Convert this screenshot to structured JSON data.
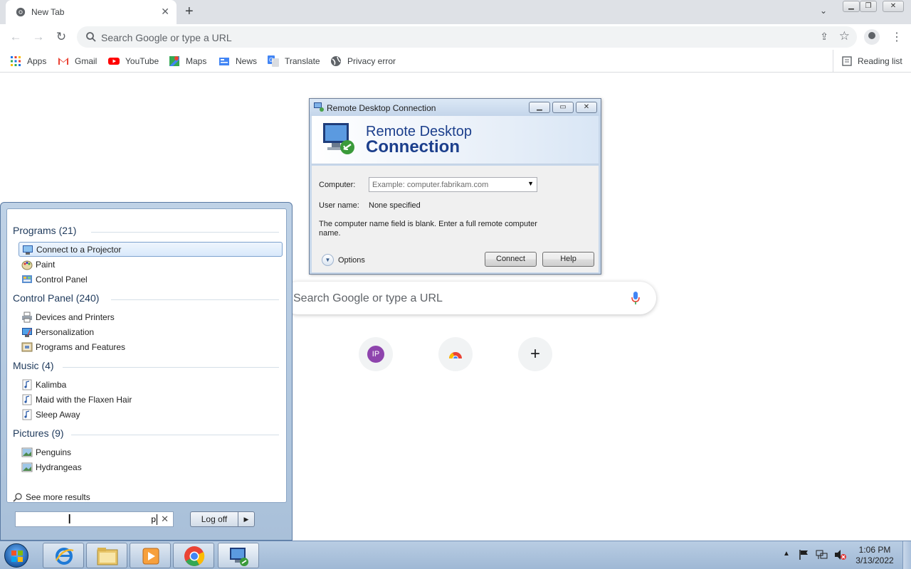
{
  "browser": {
    "tab_title": "New Tab",
    "new_tab_icon": "plus-icon",
    "omnibox_placeholder": "Search Google or type a URL",
    "bookmarks": [
      {
        "label": "Apps",
        "icon": "apps-grid-icon"
      },
      {
        "label": "Gmail",
        "icon": "gmail-icon"
      },
      {
        "label": "YouTube",
        "icon": "youtube-icon"
      },
      {
        "label": "Maps",
        "icon": "maps-icon"
      },
      {
        "label": "News",
        "icon": "news-icon"
      },
      {
        "label": "Translate",
        "icon": "translate-icon"
      },
      {
        "label": "Privacy error",
        "icon": "globe-icon"
      }
    ],
    "reading_list": "Reading list"
  },
  "ntp": {
    "search_placeholder": "Search Google or type a URL",
    "shortcuts": [
      {
        "initials": "IP",
        "color": "#8e44ad"
      },
      {
        "icon": "chrome-icon"
      },
      {
        "icon": "add-shortcut-icon",
        "glyph": "+"
      }
    ]
  },
  "rdc_dialog": {
    "window_title": "Remote Desktop Connection",
    "banner_line1": "Remote Desktop",
    "banner_line2": "Connection",
    "computer_label": "Computer:",
    "computer_placeholder": "Example: computer.fabrikam.com",
    "username_label": "User name:",
    "username_value": "None specified",
    "message": "The computer name field is blank. Enter a full remote computer name.",
    "options_label": "Options",
    "connect_label": "Connect",
    "help_label": "Help"
  },
  "start_menu": {
    "groups": [
      {
        "title": "Programs (21)",
        "items": [
          {
            "label": "Connect to a Projector",
            "icon": "projector-icon",
            "selected": true
          },
          {
            "label": "Paint",
            "icon": "paint-icon"
          },
          {
            "label": "Control Panel",
            "icon": "control-panel-icon"
          }
        ]
      },
      {
        "title": "Control Panel (240)",
        "items": [
          {
            "label": "Devices and Printers",
            "icon": "printer-icon"
          },
          {
            "label": "Personalization",
            "icon": "personalization-icon"
          },
          {
            "label": "Programs and Features",
            "icon": "programs-features-icon"
          }
        ]
      },
      {
        "title": "Music (4)",
        "items": [
          {
            "label": "Kalimba",
            "icon": "music-file-icon"
          },
          {
            "label": "Maid with the Flaxen Hair",
            "icon": "music-file-icon"
          },
          {
            "label": "Sleep Away",
            "icon": "music-file-icon"
          }
        ]
      },
      {
        "title": "Pictures (9)",
        "items": [
          {
            "label": "Penguins",
            "icon": "picture-file-icon"
          },
          {
            "label": "Hydrangeas",
            "icon": "picture-file-icon"
          }
        ]
      }
    ],
    "see_more": "See more results",
    "search_value": "p",
    "logoff_label": "Log off"
  },
  "taskbar": {
    "pinned": [
      "internet-explorer-icon",
      "file-explorer-icon",
      "media-player-icon",
      "chrome-icon",
      "remote-desktop-icon"
    ],
    "clock_time": "1:06 PM",
    "clock_date": "3/13/2022"
  },
  "colors": {
    "accent": "#1a73e8",
    "rdc_banner_text": "#1c3f8c",
    "start_group_text": "#1e395b"
  }
}
